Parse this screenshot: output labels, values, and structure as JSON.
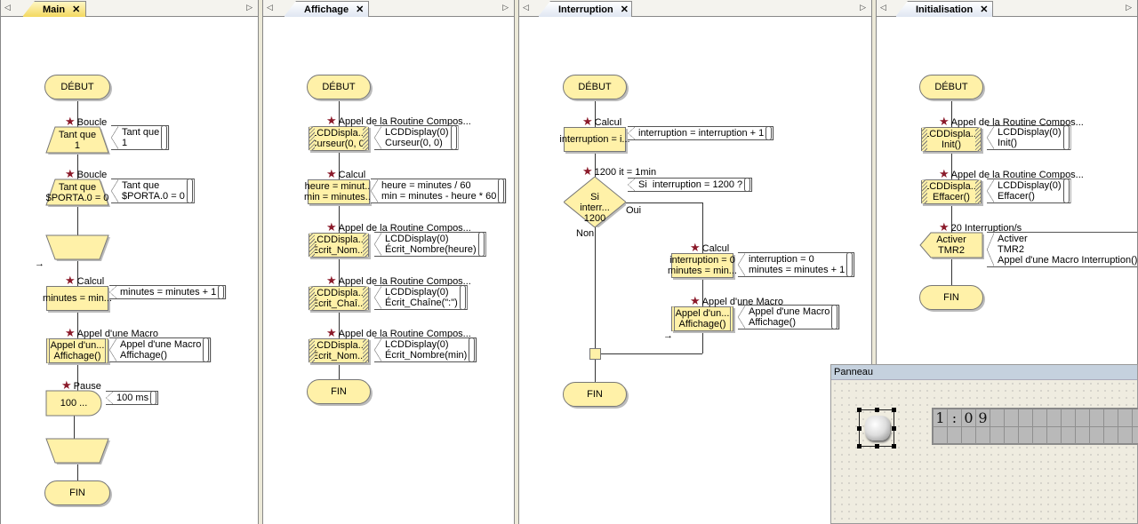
{
  "colors": {
    "node_fill": "#fff1a8",
    "active_tab": "#f3d860",
    "star": "#8b1a2a",
    "panel_header": "#c5d1de"
  },
  "panels": [
    {
      "tab": "Main",
      "active": true,
      "nodes": [
        {
          "type": "terminal",
          "text": "DÉBUT"
        },
        {
          "type": "loop-start",
          "label": "Boucle",
          "text": "Tant que\n1",
          "comment": "Tant que\n1"
        },
        {
          "type": "loop-start",
          "label": "Boucle",
          "text": "Tant que\n$PORTA.0 = 0",
          "comment": "Tant que\n$PORTA.0 = 0"
        },
        {
          "type": "loop-end",
          "text": ""
        },
        {
          "type": "calc",
          "label": "Calcul",
          "text": "minutes = min...",
          "comment": "minutes = minutes + 1"
        },
        {
          "type": "macro",
          "label": "Appel d'une Macro",
          "text": "Appel d'un...\nAffichage()",
          "comment": "Appel d'une Macro\nAffichage()"
        },
        {
          "type": "delay",
          "label": "Pause",
          "text": "100 ...",
          "comment": "100 ms"
        },
        {
          "type": "loop-end",
          "text": ""
        },
        {
          "type": "terminal",
          "text": "FIN"
        }
      ]
    },
    {
      "tab": "Affichage",
      "active": false,
      "nodes": [
        {
          "type": "terminal",
          "text": "DÉBUT"
        },
        {
          "type": "component",
          "label": "Appel de la Routine Compos...",
          "text": "LCDDispla...\nCurseur(0, 0)",
          "comment": "LCDDisplay(0)\nCurseur(0, 0)"
        },
        {
          "type": "calc",
          "label": "Calcul",
          "text": "heure = minut...\nmin = minutes...",
          "comment": "heure = minutes / 60\nmin = minutes - heure * 60"
        },
        {
          "type": "component",
          "label": "Appel de la Routine Compos...",
          "text": "LCDDispla...\nÉcrit_Nom...",
          "comment": "LCDDisplay(0)\nÉcrit_Nombre(heure)"
        },
        {
          "type": "component",
          "label": "Appel de la Routine Compos...",
          "text": "LCDDispla...\nÉcrit_Chaî...",
          "comment": "LCDDisplay(0)\nÉcrit_Chaîne(\":\")"
        },
        {
          "type": "component",
          "label": "Appel de la Routine Compos...",
          "text": "LCDDispla...\nÉcrit_Nom...",
          "comment": "LCDDisplay(0)\nÉcrit_Nombre(min)"
        },
        {
          "type": "terminal",
          "text": "FIN"
        }
      ]
    },
    {
      "tab": "Interruption",
      "active": false,
      "nodes": [
        {
          "type": "terminal",
          "text": "DÉBUT"
        },
        {
          "type": "calc",
          "label": "Calcul",
          "text": "interruption = i...",
          "comment": "interruption = interruption + 1"
        },
        {
          "type": "decision",
          "label": "1200 it = 1min",
          "text": "Si\ninterr...\n1200",
          "comment": "Si  interruption = 1200 ?",
          "yes": "Oui",
          "no": "Non"
        },
        {
          "type": "calc",
          "label": "Calcul",
          "text": "interruption = 0\nminutes = min...",
          "comment": "interruption = 0\nminutes = minutes + 1"
        },
        {
          "type": "macro",
          "label": "Appel d'une Macro",
          "text": "Appel d'un...\nAffichage()",
          "comment": "Appel d'une Macro\nAffichage()"
        },
        {
          "type": "connector",
          "text": ""
        },
        {
          "type": "terminal",
          "text": "FIN"
        }
      ]
    },
    {
      "tab": "Initialisation",
      "active": false,
      "nodes": [
        {
          "type": "terminal",
          "text": "DÉBUT"
        },
        {
          "type": "component",
          "label": "Appel de la Routine Compos...",
          "text": "LCDDispla...\nInit()",
          "comment": "LCDDisplay(0)\nInit()"
        },
        {
          "type": "component",
          "label": "Appel de la Routine Compos...",
          "text": "LCDDispla...\nEffacer()",
          "comment": "LCDDisplay(0)\nEffacer()"
        },
        {
          "type": "interrupt",
          "label": "20 Interruption/s",
          "text": "Activer\nTMR2",
          "comment": "Activer\nTMR2\nAppel d'une Macro Interruption()"
        },
        {
          "type": "terminal",
          "text": "FIN"
        }
      ]
    }
  ],
  "panneau": {
    "title": "Panneau",
    "lcd_row1": [
      "1",
      ":",
      "0",
      "9"
    ]
  }
}
